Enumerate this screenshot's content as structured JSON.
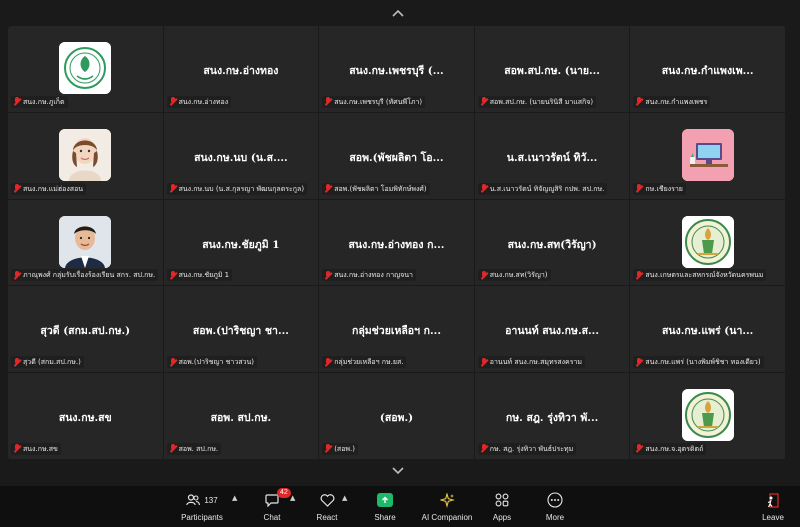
{
  "colors": {
    "background": "#1a1a1a",
    "tile": "#262626",
    "toolbar": "#0f0f0f",
    "mute": "#e02828",
    "share": "#1fb86b"
  },
  "tiles": [
    {
      "center": "",
      "label": "สนง.กษ.ภูเก็ต",
      "avatar": "seal"
    },
    {
      "center": "สนง.กษ.อ่างทอง",
      "label": "สนง.กษ.อ่างทอง"
    },
    {
      "center": "สนง.กษ.เพชรบุรี (...",
      "label": "สนง.กษ.เพชรบุรี (ทัศนพีโภา)"
    },
    {
      "center": "สอพ.สป.กษ. (นาย...",
      "label": "สอพ.สป.กษ. (นายนรินิสี มาแสกิจ)"
    },
    {
      "center": "สนง.กษ.กำแพงเพ...",
      "label": "สนง.กษ.กำแพงเพชร"
    },
    {
      "center": "",
      "label": "สนง.กษ.แม่ฮ่องสอน",
      "avatar": "woman"
    },
    {
      "center": "สนง.กษ.นบ (น.ส....",
      "label": "สนง.กษ.นบ (น.ส.กุลรญา พัฒนกุลตระกูล)"
    },
    {
      "center": "สอพ.(พัชผลิตา โอ...",
      "label": "สอพ.(พัชผลิตา โอมพิทักษ์พงศ์)"
    },
    {
      "center": "น.ส.เนาวรัตน์ ทิวั...",
      "label": "น.ส.เนาวรัตน์ ทิจัญญูสิริ กปพ. สป.กษ."
    },
    {
      "center": "",
      "label": "กษ.เชียงราย",
      "avatar": "desk"
    },
    {
      "center": "",
      "label": "ภาณุพงศ์ กลุ่มรับเรื่องร้องเรียน สกร. สป.กษ.",
      "avatar": "man"
    },
    {
      "center": "สนง.กษ.ชัยภูมิ 1",
      "label": "สนง.กษ.ชัยภูมิ 1"
    },
    {
      "center": "สนง.กษ.อ่างทอง ก...",
      "label": "สนง.กษ.อ่างทอง กาญจนา"
    },
    {
      "center": "สนง.กษ.สท(วิรัญา)",
      "label": "สนง.กษ.สท(วิรัญา)"
    },
    {
      "center": "",
      "label": "สนง.เกษตรและสหกรณ์จังหวัดนครพนม",
      "avatar": "emblem"
    },
    {
      "center": "สุวดี (สกม.สป.กษ.)",
      "label": "สุวดี (สกม.สป.กษ.)"
    },
    {
      "center": "สอพ.(ปาริชญา ชา...",
      "label": "สอพ.(ปาริชญา ชาวสวน)"
    },
    {
      "center": "กลุ่มช่วยเหลือฯ ก...",
      "label": "กลุ่มช่วยเหลือฯ กษ.ยส."
    },
    {
      "center": "อานนท์ สนง.กษ.ส...",
      "label": "อานนท์ สนง.กษ.สมุทรสงคราม"
    },
    {
      "center": "สนง.กษ.แพร่ (นา...",
      "label": "สนง.กษ.แพร่ (นางพิมพ์ชิชา ทองเดียว)"
    },
    {
      "center": "สนง.กษ.สข",
      "label": "สนง.กษ.สข"
    },
    {
      "center": "สอพ. สป.กษ.",
      "label": "สอพ. สป.กษ."
    },
    {
      "center": "(สอพ.)",
      "label": "(สอพ.)"
    },
    {
      "center": "กษ. สฎ. รุ่งทิวา พั...",
      "label": "กษ. สฎ. รุ่งทิวา พันธ์ประทุม"
    },
    {
      "center": "",
      "label": "สนง.กษ.จ.อุตรดิตถ์",
      "avatar": "emblem"
    }
  ],
  "toolbar": {
    "participants_label": "Participants",
    "participants_count": "137",
    "chat_label": "Chat",
    "chat_badge": "42",
    "react_label": "React",
    "share_label": "Share",
    "ai_label": "AI Companion",
    "apps_label": "Apps",
    "more_label": "More",
    "leave_label": "Leave"
  }
}
